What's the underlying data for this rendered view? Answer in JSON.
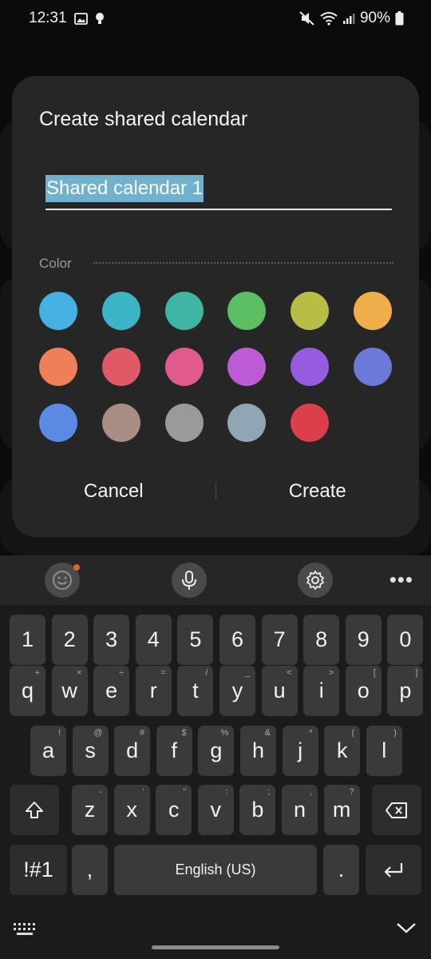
{
  "status_bar": {
    "time": "12:31",
    "battery": "90%",
    "icons": [
      "gallery-icon",
      "bulb-icon",
      "mute-icon",
      "wifi-icon",
      "signal-icon",
      "battery-icon"
    ]
  },
  "dialog": {
    "title": "Create shared calendar",
    "name_value": "Shared calendar 1",
    "color_label": "Color",
    "colors": [
      "#45b1e2",
      "#3bb4c5",
      "#3fb5a3",
      "#5cbe62",
      "#b8bd46",
      "#efae49",
      "#ef7f57",
      "#df5a66",
      "#e05a8d",
      "#bc5bd3",
      "#965ce0",
      "#6b7ad6",
      "#5a8ae3",
      "#a88e84",
      "#9a9a9a",
      "#8fa6b4",
      "#dc3f4a"
    ],
    "cancel_label": "Cancel",
    "create_label": "Create"
  },
  "keyboard": {
    "number_row": [
      "1",
      "2",
      "3",
      "4",
      "5",
      "6",
      "7",
      "8",
      "9",
      "0"
    ],
    "row1": [
      {
        "k": "q",
        "s": "+"
      },
      {
        "k": "w",
        "s": "×"
      },
      {
        "k": "e",
        "s": "÷"
      },
      {
        "k": "r",
        "s": "="
      },
      {
        "k": "t",
        "s": "/"
      },
      {
        "k": "y",
        "s": "_"
      },
      {
        "k": "u",
        "s": "<"
      },
      {
        "k": "i",
        "s": ">"
      },
      {
        "k": "o",
        "s": "["
      },
      {
        "k": "p",
        "s": "]"
      }
    ],
    "row2": [
      {
        "k": "a",
        "s": "!"
      },
      {
        "k": "s",
        "s": "@"
      },
      {
        "k": "d",
        "s": "#"
      },
      {
        "k": "f",
        "s": "$"
      },
      {
        "k": "g",
        "s": "%"
      },
      {
        "k": "h",
        "s": "&"
      },
      {
        "k": "j",
        "s": "*"
      },
      {
        "k": "k",
        "s": "("
      },
      {
        "k": "l",
        "s": ")"
      }
    ],
    "row3": [
      {
        "k": "z",
        "s": "-"
      },
      {
        "k": "x",
        "s": "'"
      },
      {
        "k": "c",
        "s": "\""
      },
      {
        "k": "v",
        "s": ":"
      },
      {
        "k": "b",
        "s": ";"
      },
      {
        "k": "n",
        "s": ","
      },
      {
        "k": "m",
        "s": "?"
      }
    ],
    "symbols_label": "!#1",
    "comma_label": ",",
    "space_label": "English (US)",
    "period_label": ".",
    "toolbar_icons": [
      "emoji-icon",
      "microphone-icon",
      "settings-icon",
      "more-icon"
    ]
  }
}
